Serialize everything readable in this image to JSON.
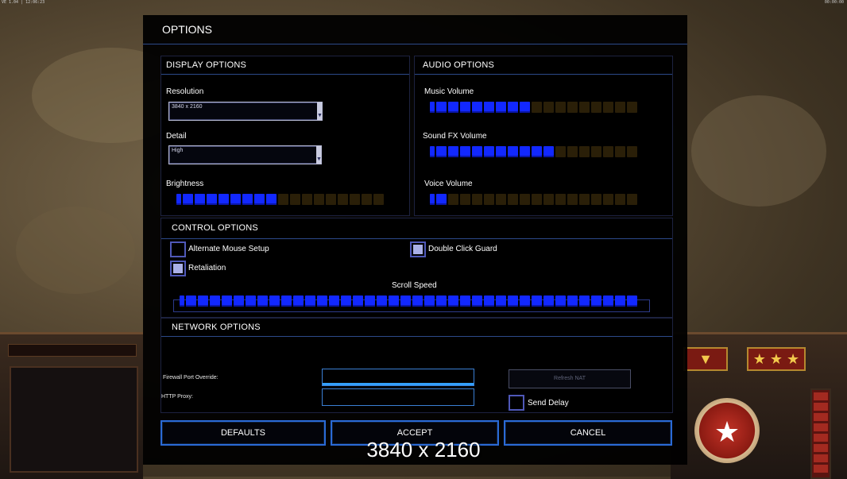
{
  "window": {
    "title": "OPTIONS"
  },
  "corner": {
    "left_text": "VE 1.04 | 12:06:23",
    "right_text": "00:00:00"
  },
  "hud": {
    "stars": "★ ★ ★",
    "emblem_star": "★"
  },
  "display": {
    "header": "DISPLAY OPTIONS",
    "resolution_label": "Resolution",
    "resolution_value": "3840 x 2160",
    "detail_label": "Detail",
    "detail_value": "High",
    "brightness_label": "Brightness",
    "brightness_level": 0.5
  },
  "audio": {
    "header": "AUDIO OPTIONS",
    "music_label": "Music Volume",
    "music_level": 0.5,
    "sfx_label": "Sound FX Volume",
    "sfx_level": 0.6,
    "voice_label": "Voice Volume",
    "voice_level": 0.1
  },
  "control": {
    "header": "CONTROL OPTIONS",
    "alt_mouse_label": "Alternate Mouse Setup",
    "alt_mouse_checked": false,
    "retaliation_label": "Retaliation",
    "retaliation_checked": true,
    "double_click_label": "Double Click Guard",
    "double_click_checked": true,
    "scroll_label": "Scroll Speed",
    "scroll_level": 1.0
  },
  "network": {
    "header": "NETWORK OPTIONS",
    "firewall_label": "Firewall Port Override:",
    "firewall_value": "",
    "proxy_label": "HTTP Proxy:",
    "proxy_value": "",
    "refresh_label": "Refresh NAT",
    "send_delay_label": "Send Delay",
    "send_delay_checked": false
  },
  "buttons": {
    "defaults": "DEFAULTS",
    "accept": "ACCEPT",
    "cancel": "CANCEL"
  },
  "overlay_text": "3840 x 2160",
  "colors": {
    "slider_on": "#1228ff",
    "slider_off": "#2a1f08",
    "accent": "#2a6ad6"
  }
}
